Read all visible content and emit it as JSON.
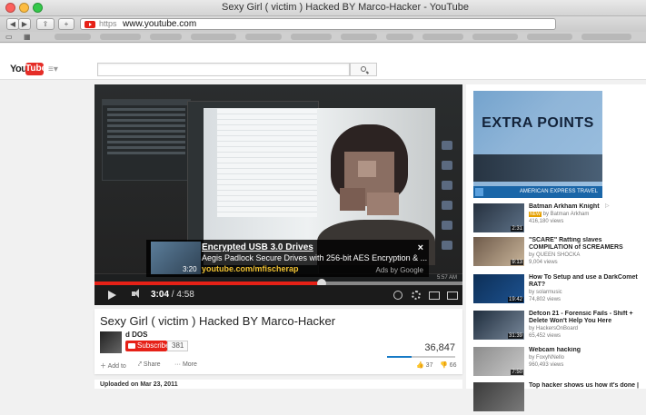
{
  "window": {
    "title": "Sexy Girl ( victim ) Hacked BY Marco-Hacker - YouTube"
  },
  "browser": {
    "url_scheme": "https",
    "url_host": "www.youtube.com"
  },
  "youtube": {
    "logo_you": "You",
    "logo_tube": "Tube"
  },
  "player": {
    "ad": {
      "duration": "3:20",
      "title": "Encrypted USB 3.0 Drives",
      "description": "Aegis Padlock Secure Drives with 256-bit AES Encryption & ...",
      "url": "youtube.com/mfischerap",
      "close": "×",
      "attribution": "Ads by Google"
    },
    "current_time": "3:04",
    "duration": "4:58",
    "progress": 0.617,
    "buffered": 0.42,
    "taskbar_clock": "5:57 AM"
  },
  "video": {
    "title": "Sexy Girl ( victim ) Hacked BY Marco-Hacker",
    "channel": "d DOS",
    "subscribe_label": "Subscribe",
    "subscriber_count": "381",
    "views": "36,847",
    "like_ratio": 0.36,
    "actions": {
      "add_to": "Add to",
      "share": "Share",
      "more": "More"
    },
    "likes": "37",
    "dislikes": "66",
    "uploaded": "Uploaded on Mar 23, 2011"
  },
  "sidebar": {
    "ad": {
      "headline": "EXTRA POINTS",
      "footer": "AMERICAN EXPRESS TRAVEL",
      "choices": "▷"
    },
    "recommendations": [
      {
        "title": "Batman Arkham Knight",
        "badge": "NEW",
        "channel": "by Batman Arkham",
        "views": "416,180 views",
        "duration": "2:31"
      },
      {
        "title": "\"SCARE\" Ratting slaves COMPILATION of SCREAMERS",
        "channel": "by QUEEN SHOCKA",
        "views": "9,004 views",
        "duration": "9:13"
      },
      {
        "title": "How To Setup and use a DarkComet RAT?",
        "channel": "by solarmusic",
        "views": "74,802 views",
        "duration": "19:42"
      },
      {
        "title": "Defcon 21 - Forensic Fails - Shift + Delete Won't Help You Here",
        "channel": "by HackersOnBoard",
        "views": "65,452 views",
        "duration": "31:39"
      },
      {
        "title": "Webcam hacking",
        "channel": "by FoxyNNello",
        "views": "960,493 views",
        "duration": "7:50"
      },
      {
        "title": "Top hacker shows us how it's done |",
        "channel": "",
        "views": "",
        "duration": ""
      }
    ]
  },
  "colors": {
    "youtube_red": "#e62117",
    "link_blue": "#167ac6",
    "ad_url": "#f1c232"
  }
}
